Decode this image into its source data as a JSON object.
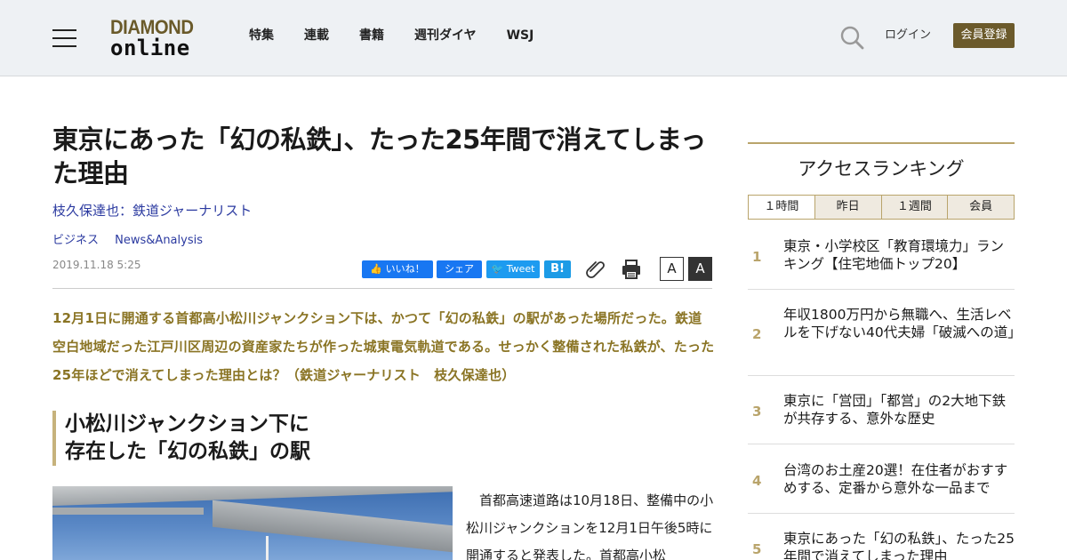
{
  "header": {
    "logo_top": "DIAMOND",
    "logo_bottom": "online",
    "nav": [
      "特集",
      "連載",
      "書籍",
      "週刊ダイヤ",
      "WSJ"
    ],
    "login_label": "ログイン",
    "register_label": "会員登録"
  },
  "article": {
    "title": "東京にあった「幻の私鉄」、たった25年間で消えてしまった理由",
    "author": "枝久保達也：鉄道ジャーナリスト",
    "tags": [
      "ビジネス",
      "News&Analysis"
    ],
    "date": "2019.11.18 5:25",
    "share": {
      "like": "いいね！",
      "share": "シェア",
      "tweet": "Tweet",
      "hatena": "B!"
    },
    "font_small": "A",
    "font_large": "A",
    "lead": "12月1日に開通する首都高小松川ジャンクション下は、かつて「幻の私鉄」の駅があった場所だった。鉄道空白地域だった江戸川区周辺の資産家たちが作った城東電気軌道である。せっかく整備された私鉄が、たった25年ほどで消えてしまった理由とは？（鉄道ジャーナリスト　枝久保達也）",
    "subhead_line1": "小松川ジャンクション下に",
    "subhead_line2": "存在した「幻の私鉄」の駅",
    "body": "首都高速道路は10月18日、整備中の小松川ジャンクションを12月1日午後5時に開通すると発表した。首都高小松"
  },
  "sidebar": {
    "title": "アクセスランキング",
    "tabs": [
      "１時間",
      "昨日",
      "１週間",
      "会員"
    ],
    "ranking": [
      {
        "rank": "1",
        "text": "東京・小学校区「教育環境力」ランキング【住宅地価トップ20】"
      },
      {
        "rank": "2",
        "text": "年収1800万円から無職へ、生活レベルを下げない40代夫婦「破滅への道」"
      },
      {
        "rank": "3",
        "text": "東京に「営団」「都営」の2大地下鉄が共存する、意外な歴史"
      },
      {
        "rank": "4",
        "text": "台湾のお土産20選！在住者がおすすめする、定番から意外な一品まで"
      },
      {
        "rank": "5",
        "text": "東京にあった「幻の私鉄」、たった25年間で消えてしまった理由"
      }
    ]
  },
  "colors": {
    "accent": "#6b5a2b",
    "lead_text": "#8a7424",
    "link": "#2b3aa0",
    "facebook": "#1877f2",
    "twitter": "#1d9bf0"
  }
}
